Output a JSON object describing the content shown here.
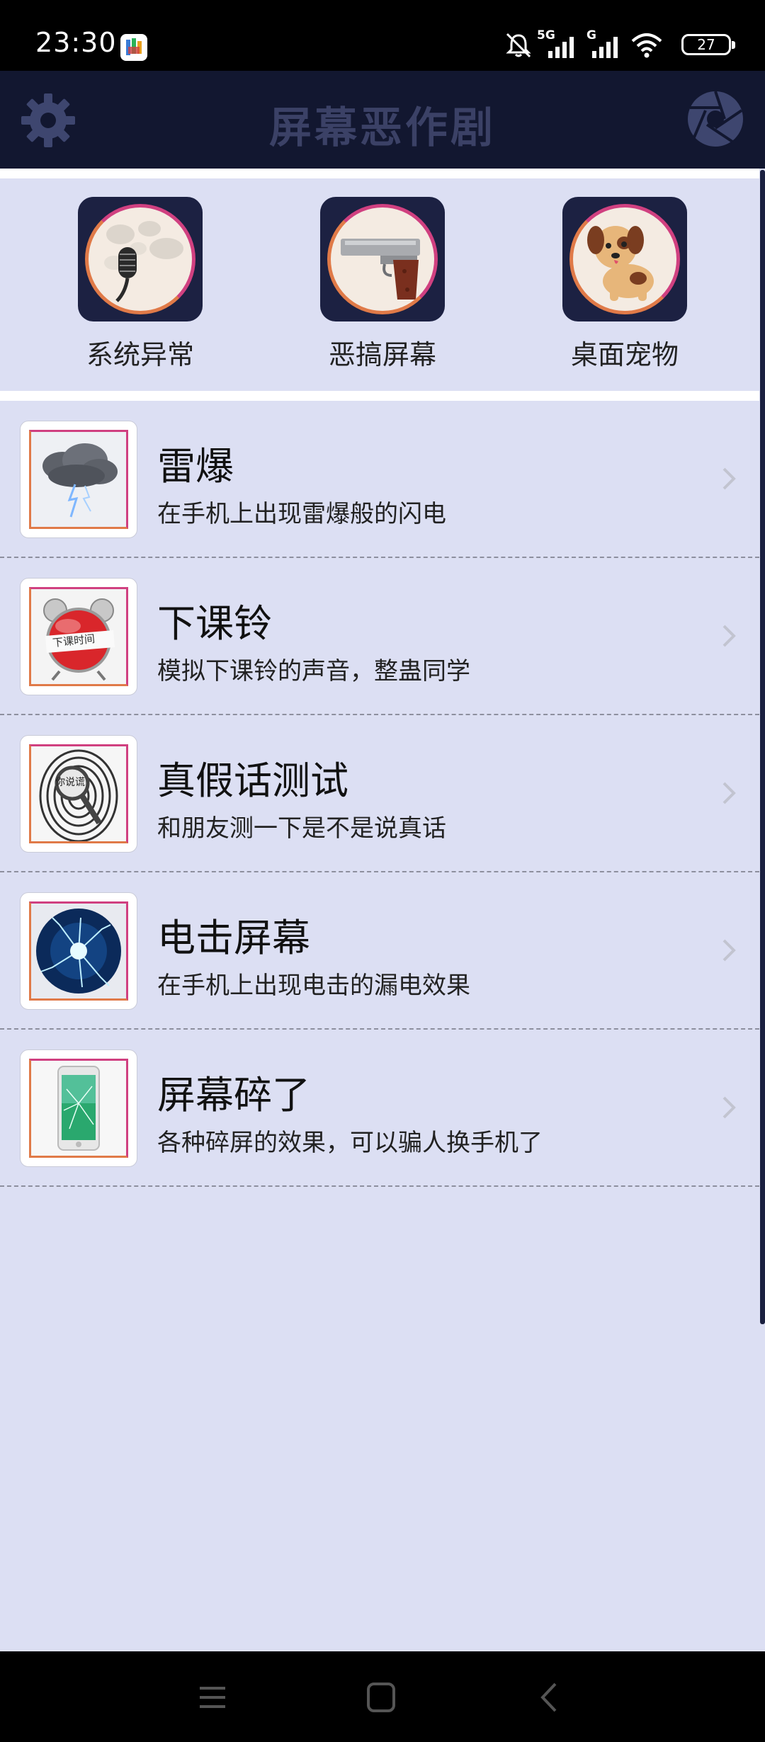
{
  "status_bar": {
    "time": "23:30",
    "battery": "27",
    "network_5g": "5G",
    "network_g": "G",
    "icons": [
      "app-badge-icon",
      "bell-muted-icon",
      "signal-5g-icon",
      "signal-g-icon",
      "wifi-icon",
      "battery-icon"
    ]
  },
  "app_bar": {
    "title": "屏幕恶作剧",
    "left_icon": "gear-icon",
    "right_icon": "camera-shutter-icon"
  },
  "quick_actions": [
    {
      "label": "系统异常",
      "icon": "microphone-icon"
    },
    {
      "label": "恶搞屏幕",
      "icon": "pistol-icon"
    },
    {
      "label": "桌面宠物",
      "icon": "puppy-icon"
    }
  ],
  "list": [
    {
      "title": "雷爆",
      "desc": "在手机上出现雷爆般的闪电",
      "icon": "storm-cloud-icon"
    },
    {
      "title": "下课铃",
      "desc": "模拟下课铃的声音，整蛊同学",
      "icon": "alarm-clock-icon",
      "badge_text": "下课时间"
    },
    {
      "title": "真假话测试",
      "desc": "和朋友测一下是不是说真话",
      "icon": "fingerprint-icon",
      "badge_text": "你说谎"
    },
    {
      "title": "电击屏幕",
      "desc": "在手机上出现电击的漏电效果",
      "icon": "electric-plasma-icon"
    },
    {
      "title": "屏幕碎了",
      "desc": "各种碎屏的效果，可以骗人换手机了",
      "icon": "cracked-phone-icon"
    }
  ],
  "nav_bar": {
    "buttons": [
      "menu-icon",
      "home-icon",
      "back-icon"
    ]
  },
  "colors": {
    "app_bar_bg": "#121730",
    "page_bg": "#dcdff3",
    "tile_bg": "#1c2142",
    "accent_pink": "#d04080",
    "accent_orange": "#e07a48"
  }
}
